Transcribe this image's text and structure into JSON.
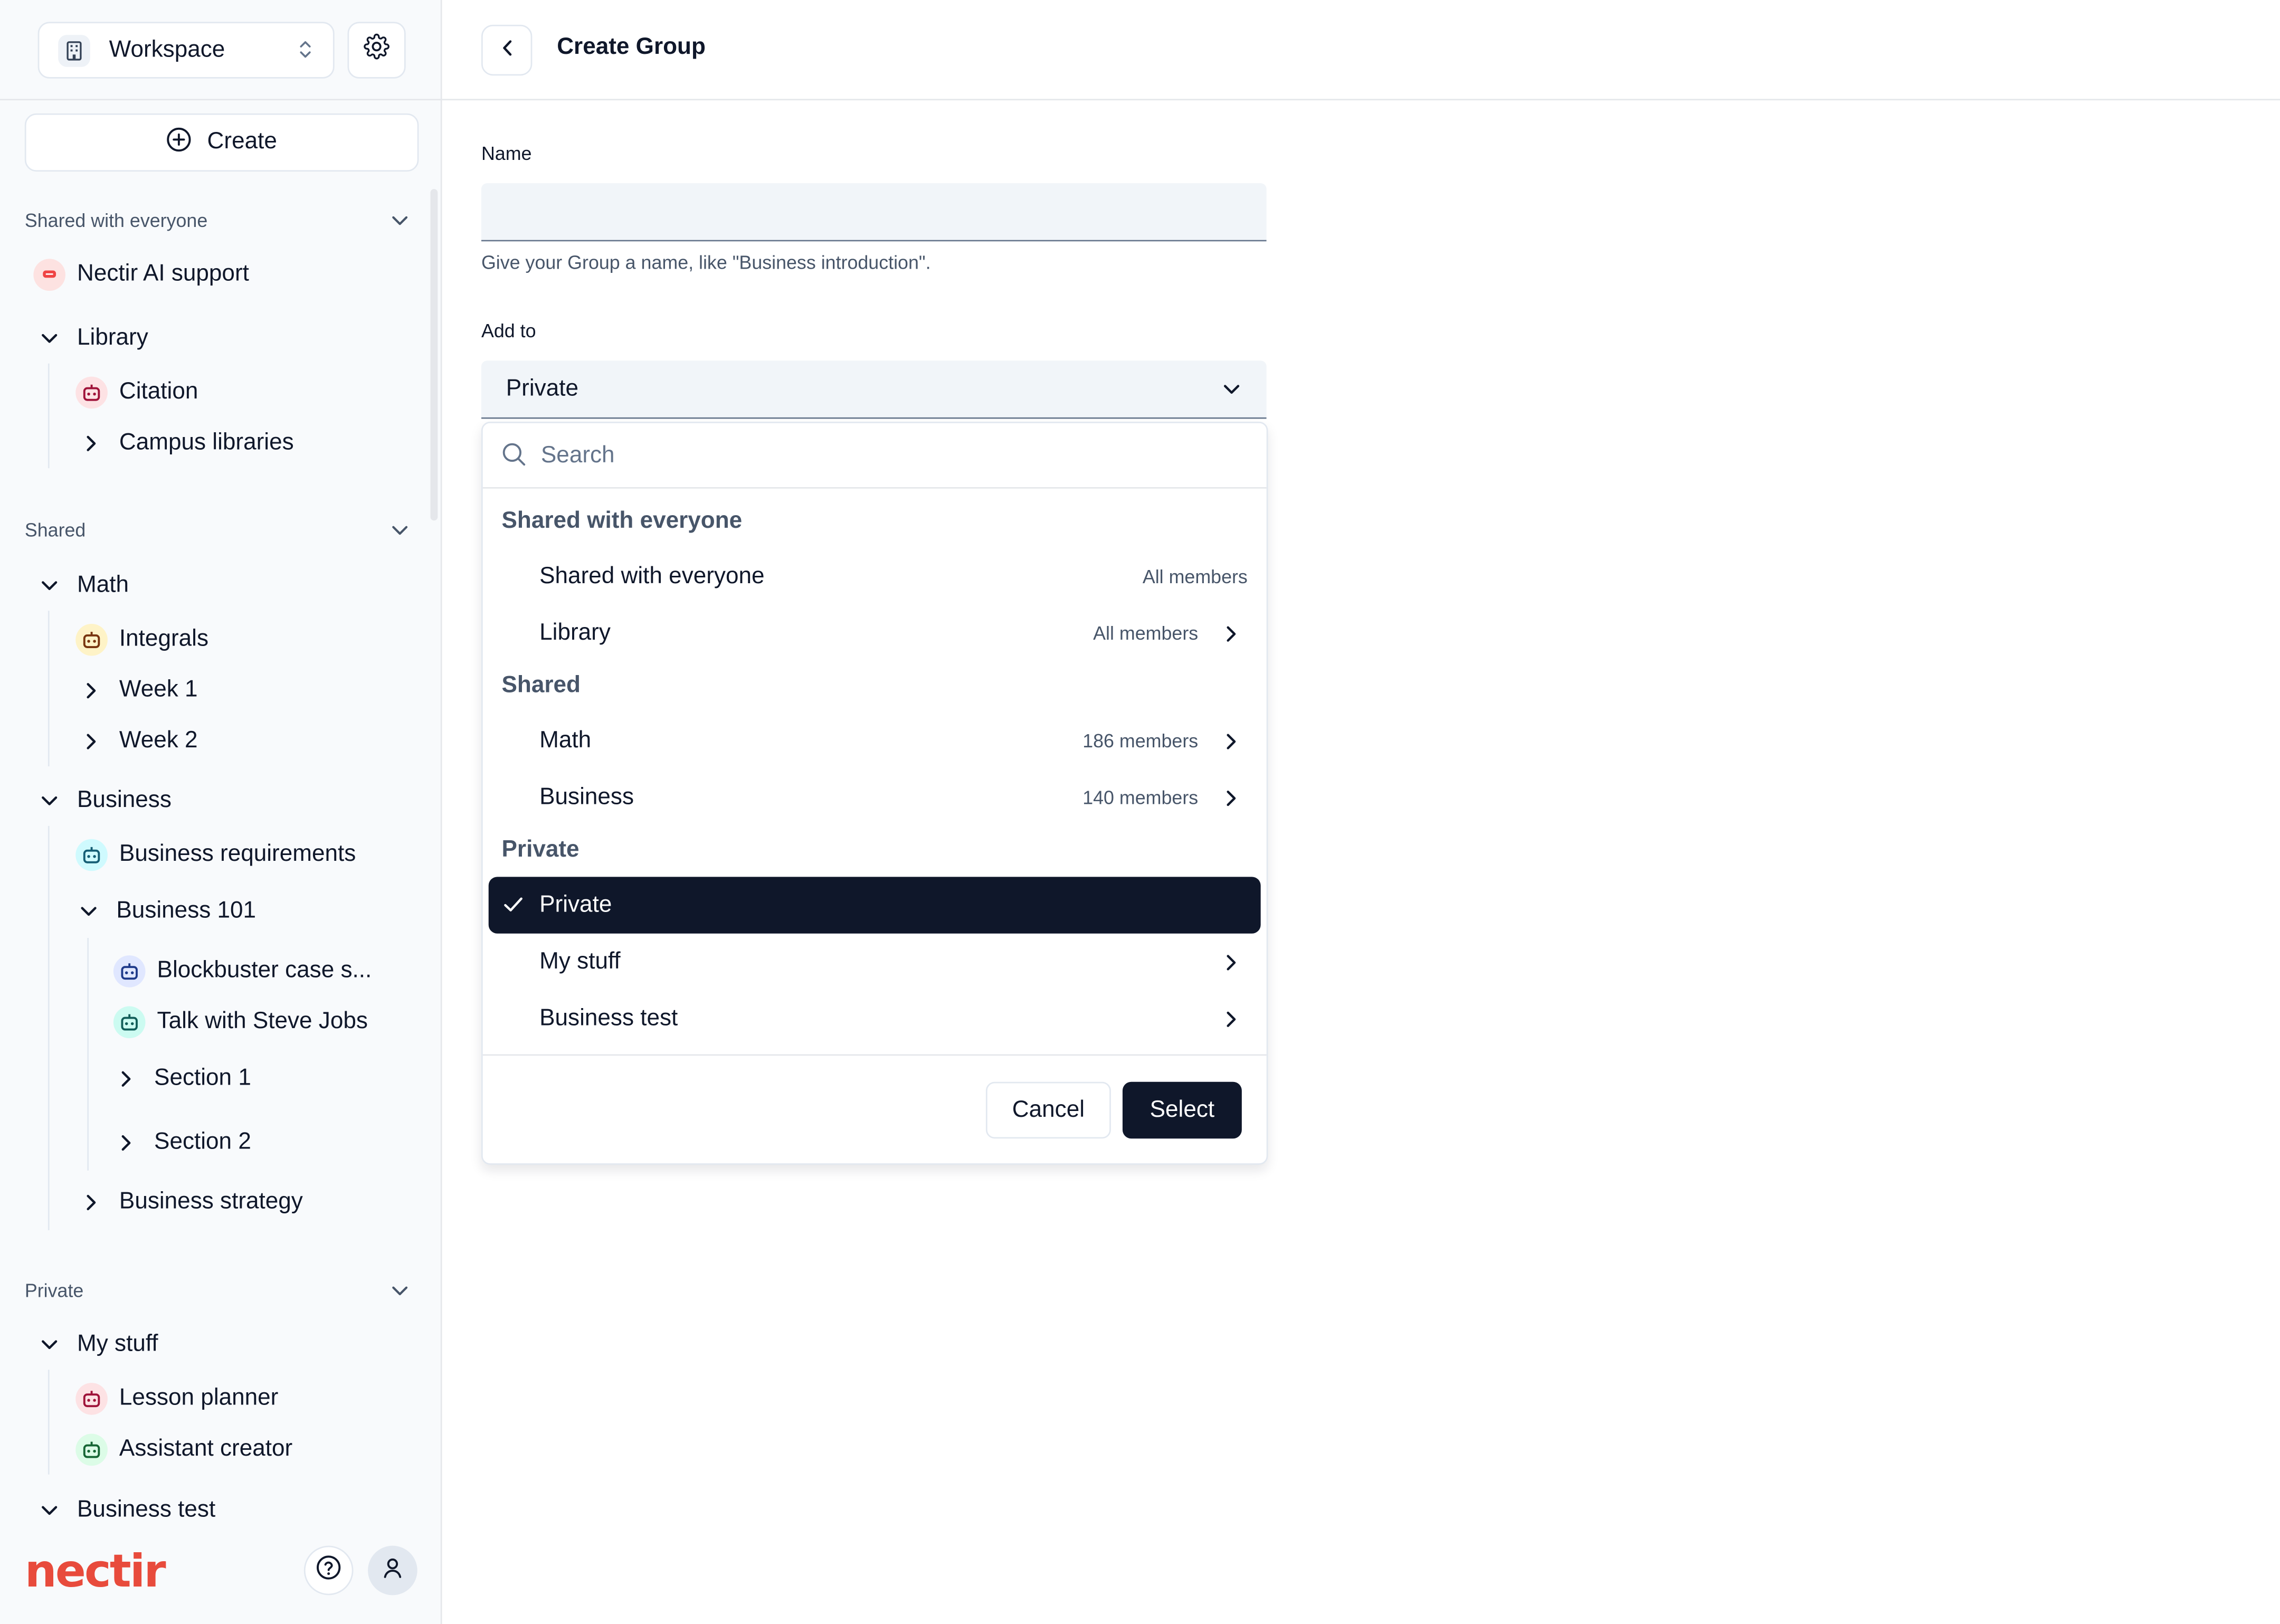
{
  "colors": {
    "brand": "#e84b3c",
    "primary": "#0f172a",
    "muted": "#475569",
    "surface": "#f1f5f9"
  },
  "sidebar": {
    "workspace_label": "Workspace",
    "create_label": "Create",
    "sections": {
      "shared_everyone": {
        "title": "Shared with everyone",
        "items": [
          "Nectir AI support",
          "Library",
          "Citation",
          "Campus libraries"
        ]
      },
      "shared": {
        "title": "Shared",
        "items": [
          "Math",
          "Integrals",
          "Week 1",
          "Week 2",
          "Business",
          "Business requirements",
          "Business 101",
          "Blockbuster case s...",
          "Talk with Steve Jobs",
          "Section 1",
          "Section 2",
          "Business strategy"
        ]
      },
      "private": {
        "title": "Private",
        "items": [
          "My stuff",
          "Lesson planner",
          "Assistant creator",
          "Business test"
        ]
      }
    },
    "logo_text": "nectir"
  },
  "header": {
    "title": "Create Group"
  },
  "form": {
    "name_label": "Name",
    "name_value": "",
    "name_helper": "Give your Group a name, like \"Business introduction\".",
    "addto_label": "Add to",
    "addto_value": "Private"
  },
  "dropdown": {
    "search_placeholder": "Search",
    "groups": [
      {
        "title": "Shared with everyone",
        "options": [
          {
            "label": "Shared with everyone",
            "meta": "All members"
          },
          {
            "label": "Library",
            "meta": "All members"
          }
        ]
      },
      {
        "title": "Shared",
        "options": [
          {
            "label": "Math",
            "meta": "186 members"
          },
          {
            "label": "Business",
            "meta": "140 members"
          }
        ]
      },
      {
        "title": "Private",
        "options": [
          {
            "label": "Private",
            "meta": ""
          },
          {
            "label": "My stuff",
            "meta": ""
          },
          {
            "label": "Business test",
            "meta": ""
          }
        ]
      }
    ],
    "cancel_label": "Cancel",
    "select_label": "Select"
  }
}
